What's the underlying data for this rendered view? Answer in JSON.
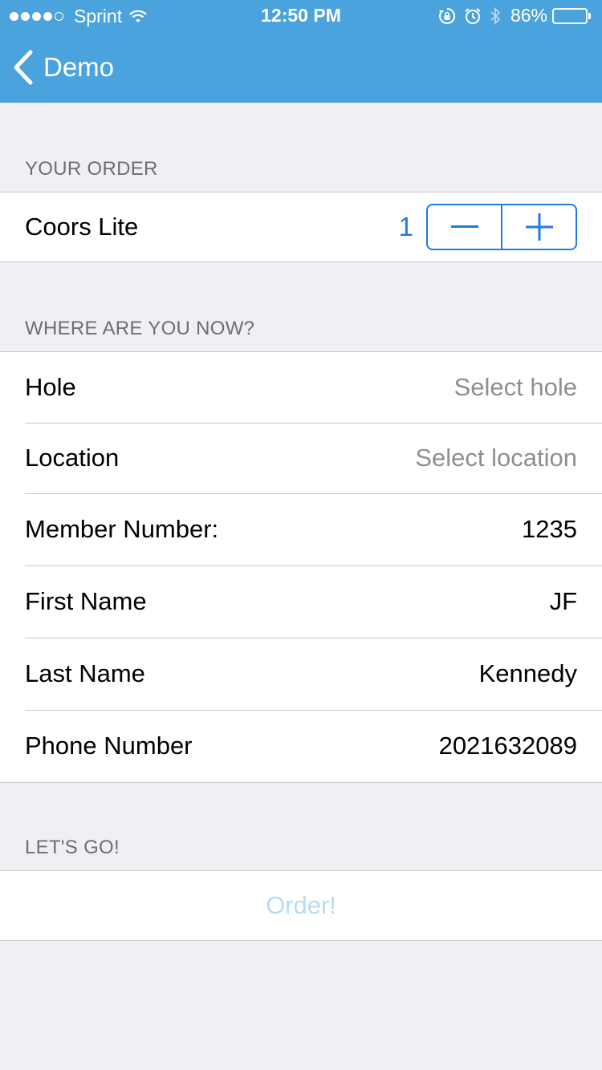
{
  "status_bar": {
    "carrier": "Sprint",
    "time": "12:50 PM",
    "battery": "86%",
    "battery_level": 0.86,
    "icons": [
      "wifi-icon",
      "rotation-lock-icon",
      "alarm-icon",
      "bluetooth-icon",
      "battery-icon"
    ]
  },
  "nav": {
    "back_label": "Demo",
    "bar_color": "#4BA3DE"
  },
  "order_section": {
    "header": "YOUR ORDER",
    "item": {
      "name": "Coors Lite",
      "quantity": "1"
    }
  },
  "location_section": {
    "header": "WHERE ARE YOU NOW?",
    "rows": [
      {
        "label": "Hole",
        "value": "Select hole",
        "placeholder": true
      },
      {
        "label": "Location",
        "value": "Select location",
        "placeholder": true
      },
      {
        "label": "Member Number:",
        "value": "1235",
        "placeholder": false
      },
      {
        "label": "First Name",
        "value": "JF",
        "placeholder": false
      },
      {
        "label": "Last Name",
        "value": "Kennedy",
        "placeholder": false
      },
      {
        "label": "Phone Number",
        "value": "2021632089",
        "placeholder": false
      }
    ]
  },
  "go_section": {
    "header": "LET'S GO!",
    "order_label": "Order!"
  },
  "colors": {
    "accent": "#1E7BE1",
    "background": "#EFEFF4",
    "disabled_button": "#B8DAF4"
  }
}
